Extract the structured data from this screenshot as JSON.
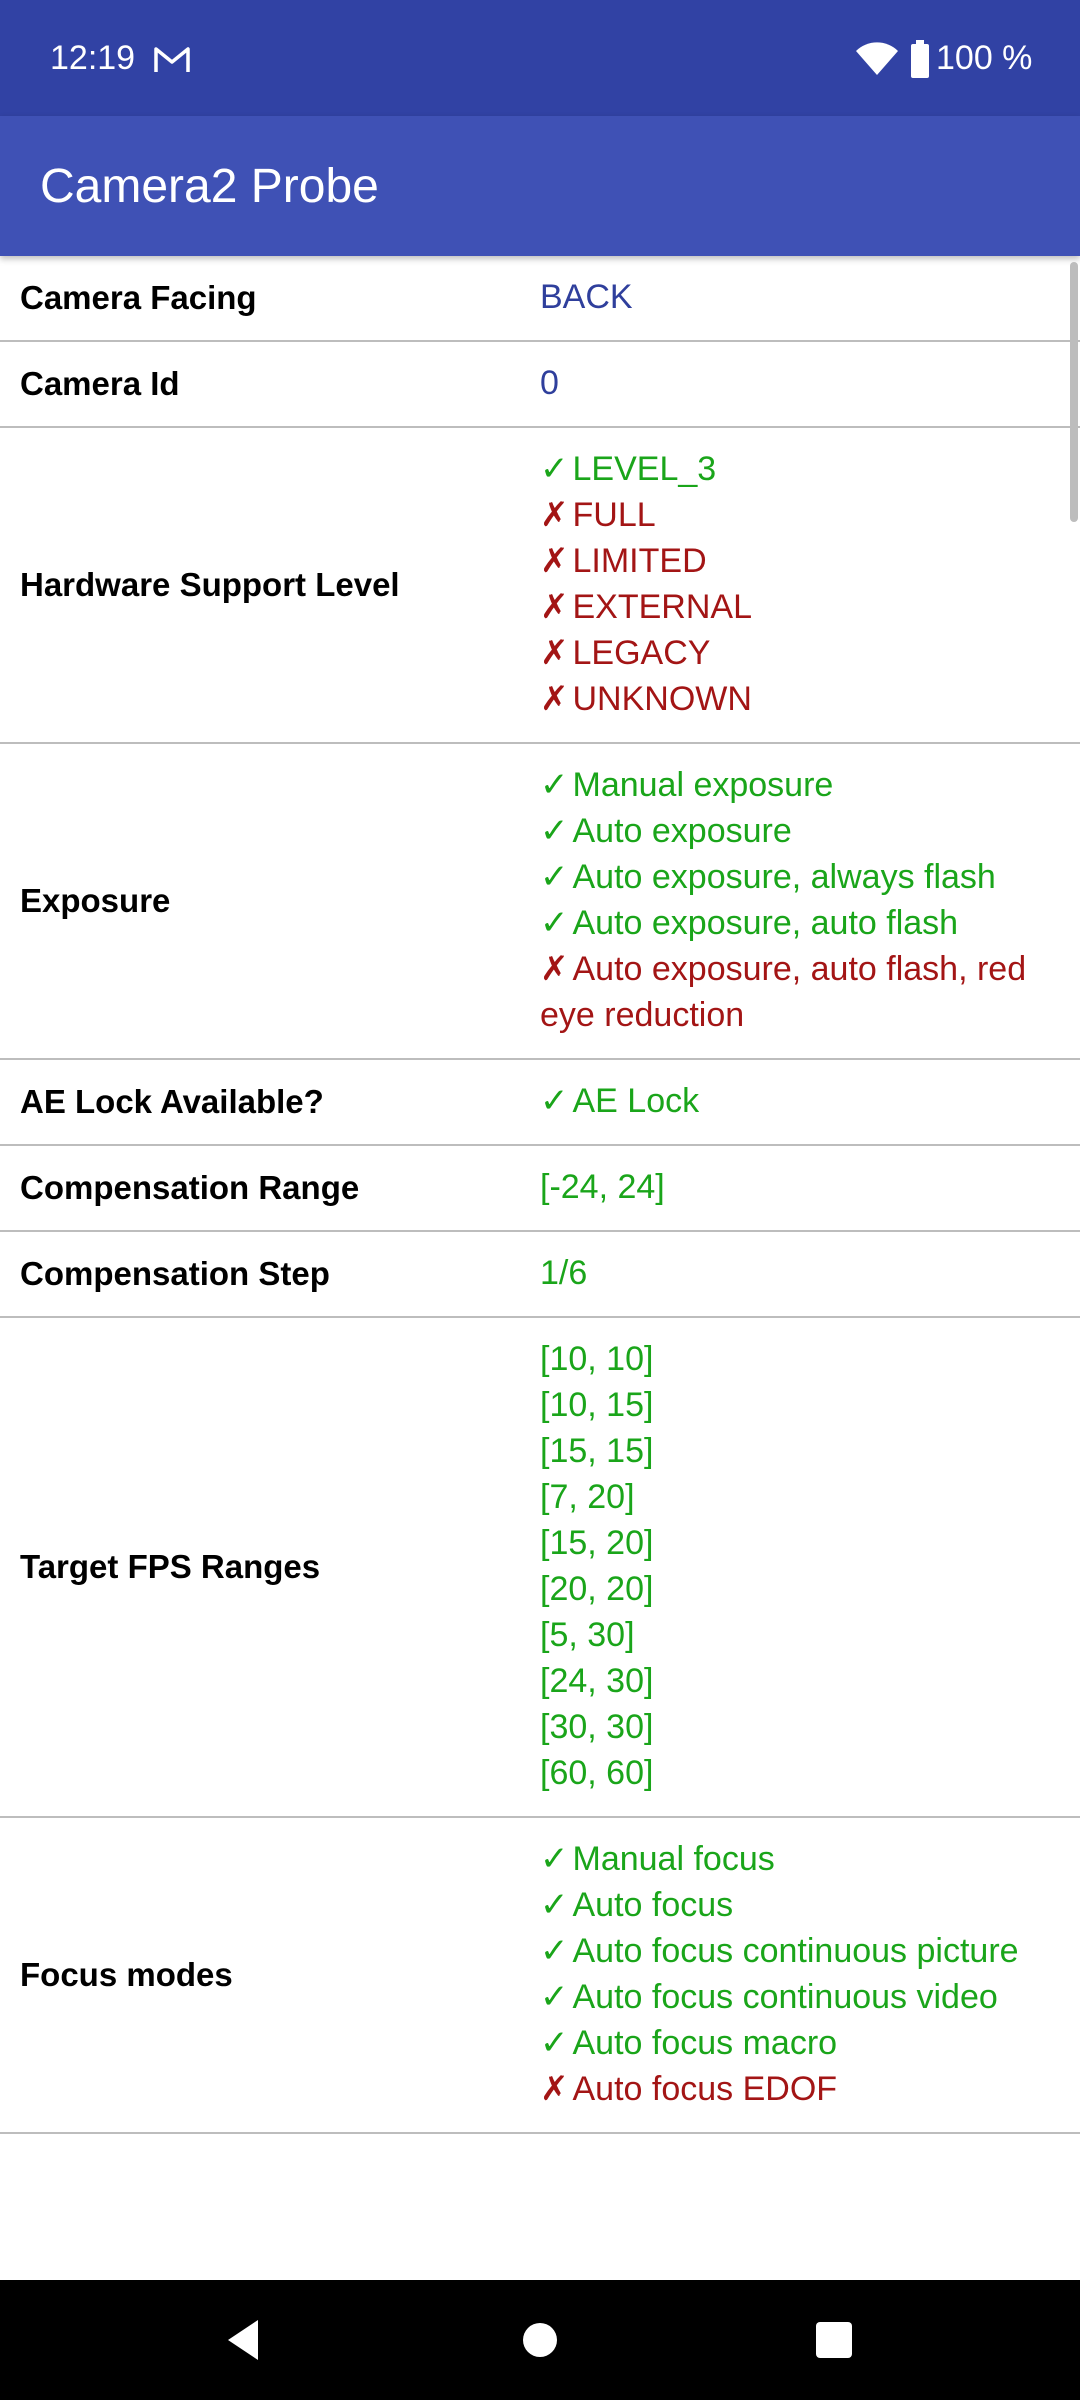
{
  "status_bar": {
    "time": "12:19",
    "battery": "100 %",
    "icons": [
      "gmail-icon",
      "wifi-icon",
      "battery-icon"
    ]
  },
  "app_bar": {
    "title": "Camera2 Probe"
  },
  "rows": [
    {
      "label": "Camera Facing",
      "values": [
        {
          "text": "BACK",
          "status": "info"
        }
      ]
    },
    {
      "label": "Camera Id",
      "values": [
        {
          "text": "0",
          "status": "info"
        }
      ]
    },
    {
      "label": "Hardware Support Level",
      "values": [
        {
          "text": "LEVEL_3",
          "status": "ok"
        },
        {
          "text": "FULL",
          "status": "no"
        },
        {
          "text": "LIMITED",
          "status": "no"
        },
        {
          "text": "EXTERNAL",
          "status": "no"
        },
        {
          "text": "LEGACY",
          "status": "no"
        },
        {
          "text": "UNKNOWN",
          "status": "no"
        }
      ]
    },
    {
      "label": "Exposure",
      "values": [
        {
          "text": "Manual exposure",
          "status": "ok"
        },
        {
          "text": "Auto exposure",
          "status": "ok"
        },
        {
          "text": "Auto exposure, always flash",
          "status": "ok"
        },
        {
          "text": "Auto exposure, auto flash",
          "status": "ok"
        },
        {
          "text": "Auto exposure, auto flash, red eye reduction",
          "status": "no"
        }
      ]
    },
    {
      "label": "AE Lock Available?",
      "values": [
        {
          "text": "AE Lock",
          "status": "ok"
        }
      ]
    },
    {
      "label": "Compensation Range",
      "values": [
        {
          "text": "[-24, 24]",
          "status": "plain"
        }
      ]
    },
    {
      "label": "Compensation Step",
      "values": [
        {
          "text": "1/6",
          "status": "plain"
        }
      ]
    },
    {
      "label": "Target FPS Ranges",
      "values": [
        {
          "text": "[10, 10]",
          "status": "plain"
        },
        {
          "text": "[10, 15]",
          "status": "plain"
        },
        {
          "text": "[15, 15]",
          "status": "plain"
        },
        {
          "text": "[7, 20]",
          "status": "plain"
        },
        {
          "text": "[15, 20]",
          "status": "plain"
        },
        {
          "text": "[20, 20]",
          "status": "plain"
        },
        {
          "text": "[5, 30]",
          "status": "plain"
        },
        {
          "text": "[24, 30]",
          "status": "plain"
        },
        {
          "text": "[30, 30]",
          "status": "plain"
        },
        {
          "text": "[60, 60]",
          "status": "plain"
        }
      ]
    },
    {
      "label": "Focus modes",
      "values": [
        {
          "text": "Manual focus",
          "status": "ok"
        },
        {
          "text": "Auto focus",
          "status": "ok"
        },
        {
          "text": "Auto focus continuous picture",
          "status": "ok"
        },
        {
          "text": "Auto focus continuous video",
          "status": "ok"
        },
        {
          "text": "Auto focus macro",
          "status": "ok"
        },
        {
          "text": "Auto focus EDOF",
          "status": "no"
        }
      ]
    }
  ],
  "marks": {
    "ok": "✓",
    "no": "✗"
  },
  "colors": {
    "status_bar": "#3142a4",
    "app_bar": "#3f51b5",
    "supported": "#1aa51a",
    "unsupported": "#a31515",
    "info": "#2f3f9c"
  },
  "nav_bar": {
    "buttons": [
      "back-icon",
      "home-icon",
      "recents-icon"
    ]
  }
}
